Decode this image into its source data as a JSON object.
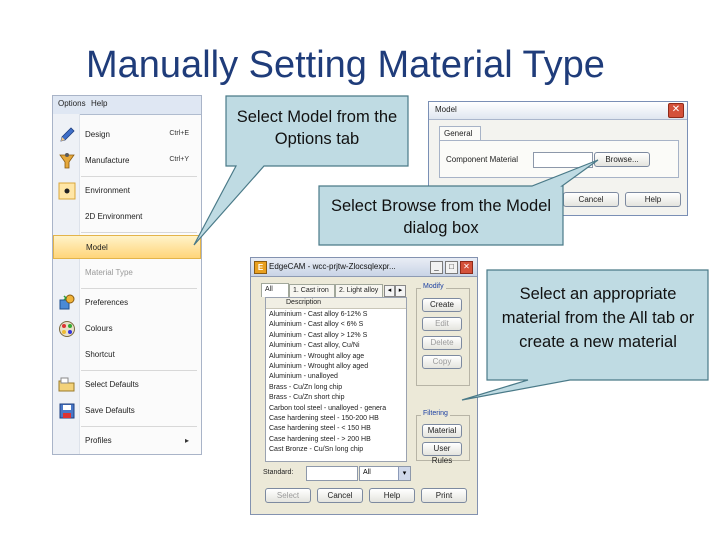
{
  "slide": {
    "title": "Manually Setting Material Type"
  },
  "menu": {
    "bar": [
      "Options",
      "Help"
    ],
    "items": [
      {
        "label": "Design",
        "shortcut": "Ctrl+E",
        "icon": "pencil-icon"
      },
      {
        "label": "Manufacture",
        "shortcut": "Ctrl+Y",
        "icon": "funnel-icon"
      },
      {
        "label": "Environment",
        "shortcut": "",
        "icon": "radio-dot-icon"
      },
      {
        "label": "2D Environment",
        "shortcut": "",
        "icon": ""
      },
      {
        "label": "Model",
        "shortcut": "",
        "icon": ""
      },
      {
        "label": "Material Type",
        "shortcut": "",
        "icon": ""
      },
      {
        "label": "Preferences",
        "shortcut": "",
        "icon": "preferences-icon"
      },
      {
        "label": "Colours",
        "shortcut": "",
        "icon": "palette-icon"
      },
      {
        "label": "Shortcut",
        "shortcut": "",
        "icon": ""
      },
      {
        "label": "Select Defaults",
        "shortcut": "",
        "icon": "folder-open-icon"
      },
      {
        "label": "Save Defaults",
        "shortcut": "",
        "icon": "save-icon"
      },
      {
        "label": "Profiles",
        "shortcut": "",
        "icon": "submenu-arrow-icon"
      }
    ],
    "submenu_arrow": "▸"
  },
  "model_dialog": {
    "title": "Model",
    "tab": "General",
    "field_label": "Component Material",
    "field_value": "",
    "browse": "Browse...",
    "cancel": "Cancel",
    "help": "Help",
    "close": "✕"
  },
  "edgecam_dialog": {
    "title": "EdgeCAM - wcc-prjtw-Zlocsqlexpr...",
    "icon_text": "E",
    "window_buttons": [
      "_",
      "□",
      "✕"
    ],
    "tabs": [
      "All",
      "1. Cast iron",
      "2. Light alloy"
    ],
    "tab_nav": [
      "◂",
      "▸"
    ],
    "list_header": "Description",
    "list_items": [
      "Aluminium - Cast alloy 6-12% S",
      "Aluminium - Cast alloy < 6% S",
      "Aluminium - Cast alloy > 12% S",
      "Aluminium - Cast alloy, Cu/Ni",
      "Aluminium - Wrought alloy age",
      "Aluminium - Wrought alloy aged",
      "Aluminium - unalloyed",
      "Brass - Cu/Zn long chip",
      "Brass - Cu/Zn short chip",
      "Carbon tool steel - unalloyed - genera",
      "Case hardening steel - 150-200 HB",
      "Case hardening steel - < 150 HB",
      "Case hardening steel - > 200 HB",
      "Cast Bronze - Cu/Sn long chip"
    ],
    "modify_label": "Modify",
    "modify_buttons": [
      "Create",
      "Edit",
      "Delete",
      "Copy"
    ],
    "filtering_label": "Filtering",
    "filter_buttons": [
      "Material",
      "User Rules"
    ],
    "standard_label": "Standard:",
    "standard_value": "All",
    "bottom_buttons": [
      "Select",
      "Cancel",
      "Help",
      "Print"
    ],
    "dropdown_arrow": "▾",
    "scroll_up": "▴",
    "scroll_down": "▾"
  },
  "callouts": [
    {
      "text": "Select Model from the Options tab"
    },
    {
      "text": "Select Browse from the Model dialog box"
    },
    {
      "text": "Select an appropriate material from the All tab or create a new material"
    }
  ],
  "colors": {
    "title": "#1f3c7a",
    "callout_fill": "#bfdbe3",
    "callout_border": "#4a7a88",
    "menu_highlight": "#ffd57a"
  }
}
